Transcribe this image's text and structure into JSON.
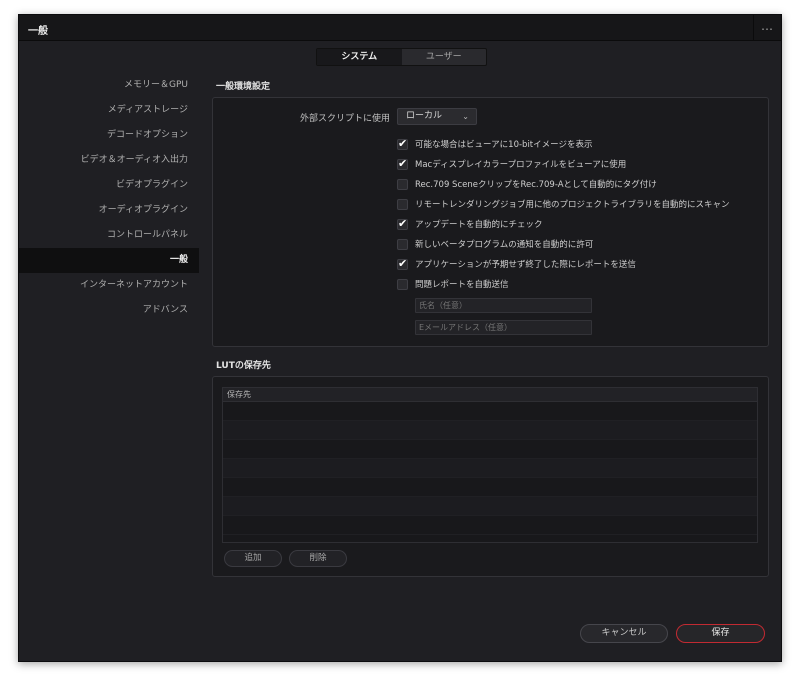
{
  "window": {
    "title": "一般",
    "more_icon": "…"
  },
  "tabs": [
    {
      "label": "システム",
      "active": true
    },
    {
      "label": "ユーザー",
      "active": false
    }
  ],
  "sidebar": {
    "items": [
      {
        "label": "メモリー＆GPU"
      },
      {
        "label": "メディアストレージ"
      },
      {
        "label": "デコードオプション"
      },
      {
        "label": "ビデオ＆オーディオ入出力"
      },
      {
        "label": "ビデオプラグイン"
      },
      {
        "label": "オーディオプラグイン"
      },
      {
        "label": "コントロールパネル"
      },
      {
        "label": "一般",
        "active": true
      },
      {
        "label": "インターネットアカウント"
      },
      {
        "label": "アドバンス"
      }
    ]
  },
  "general": {
    "section_title": "一般環境設定",
    "external_script_label": "外部スクリプトに使用",
    "external_script_value": "ローカル",
    "checkboxes": [
      {
        "label": "可能な場合はビューアに10-bitイメージを表示",
        "checked": true,
        "check": "✔"
      },
      {
        "label": "Macディスプレイカラープロファイルをビューアに使用",
        "checked": true,
        "check": "✔"
      },
      {
        "label": "Rec.709 SceneクリップをRec.709-Aとして自動的にタグ付け",
        "checked": false,
        "check": ""
      },
      {
        "label": "リモートレンダリングジョブ用に他のプロジェクトライブラリを自動的にスキャン",
        "checked": false,
        "check": ""
      },
      {
        "label": "アップデートを自動的にチェック",
        "checked": true,
        "check": "✔"
      },
      {
        "label": "新しいベータプログラムの通知を自動的に許可",
        "checked": false,
        "check": ""
      },
      {
        "label": "アプリケーションが予期せず終了した際にレポートを送信",
        "checked": true,
        "check": "✔"
      },
      {
        "label": "問題レポートを自動送信",
        "checked": false,
        "check": ""
      }
    ],
    "name_placeholder": "氏名（任意）",
    "email_placeholder": "Eメールアドレス（任意）"
  },
  "lut": {
    "section_title": "LUTの保存先",
    "table_header": "保存先",
    "add_label": "追加",
    "delete_label": "削除"
  },
  "footer": {
    "cancel_label": "キャンセル",
    "save_label": "保存"
  },
  "colors": {
    "window_bg": "#1f1f23",
    "panel_bg": "#1a1a1d",
    "save_border": "#c22a32"
  }
}
